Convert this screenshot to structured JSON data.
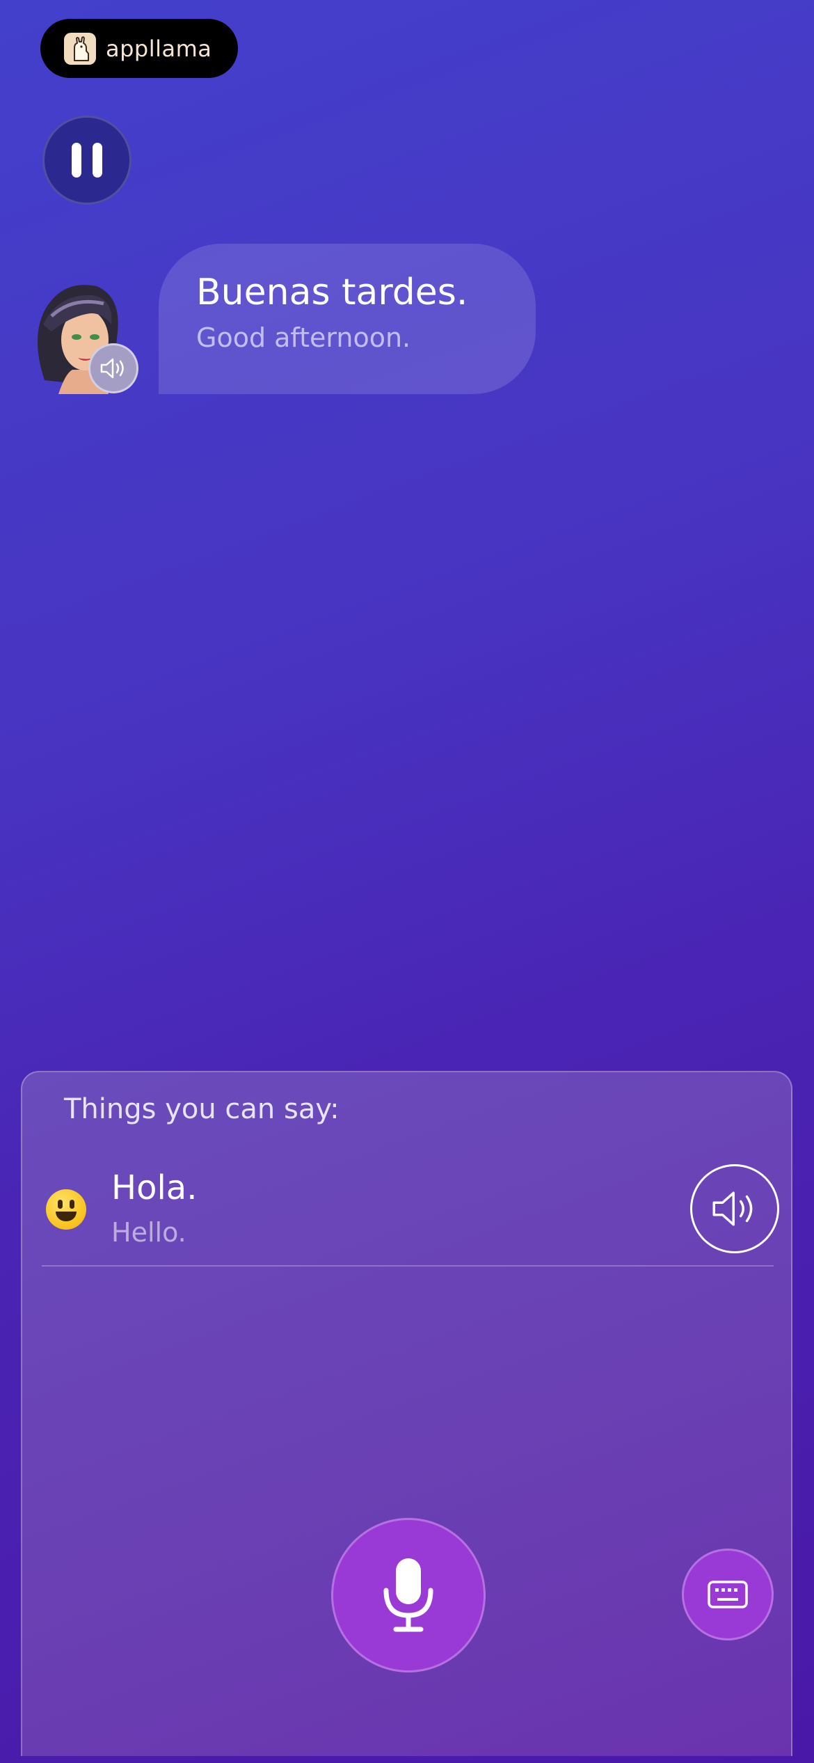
{
  "brand": {
    "name": "appllama",
    "logo_icon": "llama-logo-icon"
  },
  "controls": {
    "pause_icon": "pause-icon"
  },
  "conversation": {
    "messages": [
      {
        "speaker": "tutor",
        "text": "Buenas tardes.",
        "translation": "Good afternoon.",
        "audio_icon": "speaker-icon"
      }
    ]
  },
  "suggestions_panel": {
    "title": "Things you can say:",
    "items": [
      {
        "emoji": "😃",
        "text": "Hola.",
        "translation": "Hello.",
        "audio_icon": "speaker-icon"
      }
    ]
  },
  "input": {
    "mic_icon": "microphone-icon",
    "keyboard_icon": "keyboard-icon"
  },
  "colors": {
    "background_top": "#4340cc",
    "background_bottom": "#4a18a8",
    "accent_button": "#9a3ad6",
    "pause_button": "#2b2890"
  }
}
